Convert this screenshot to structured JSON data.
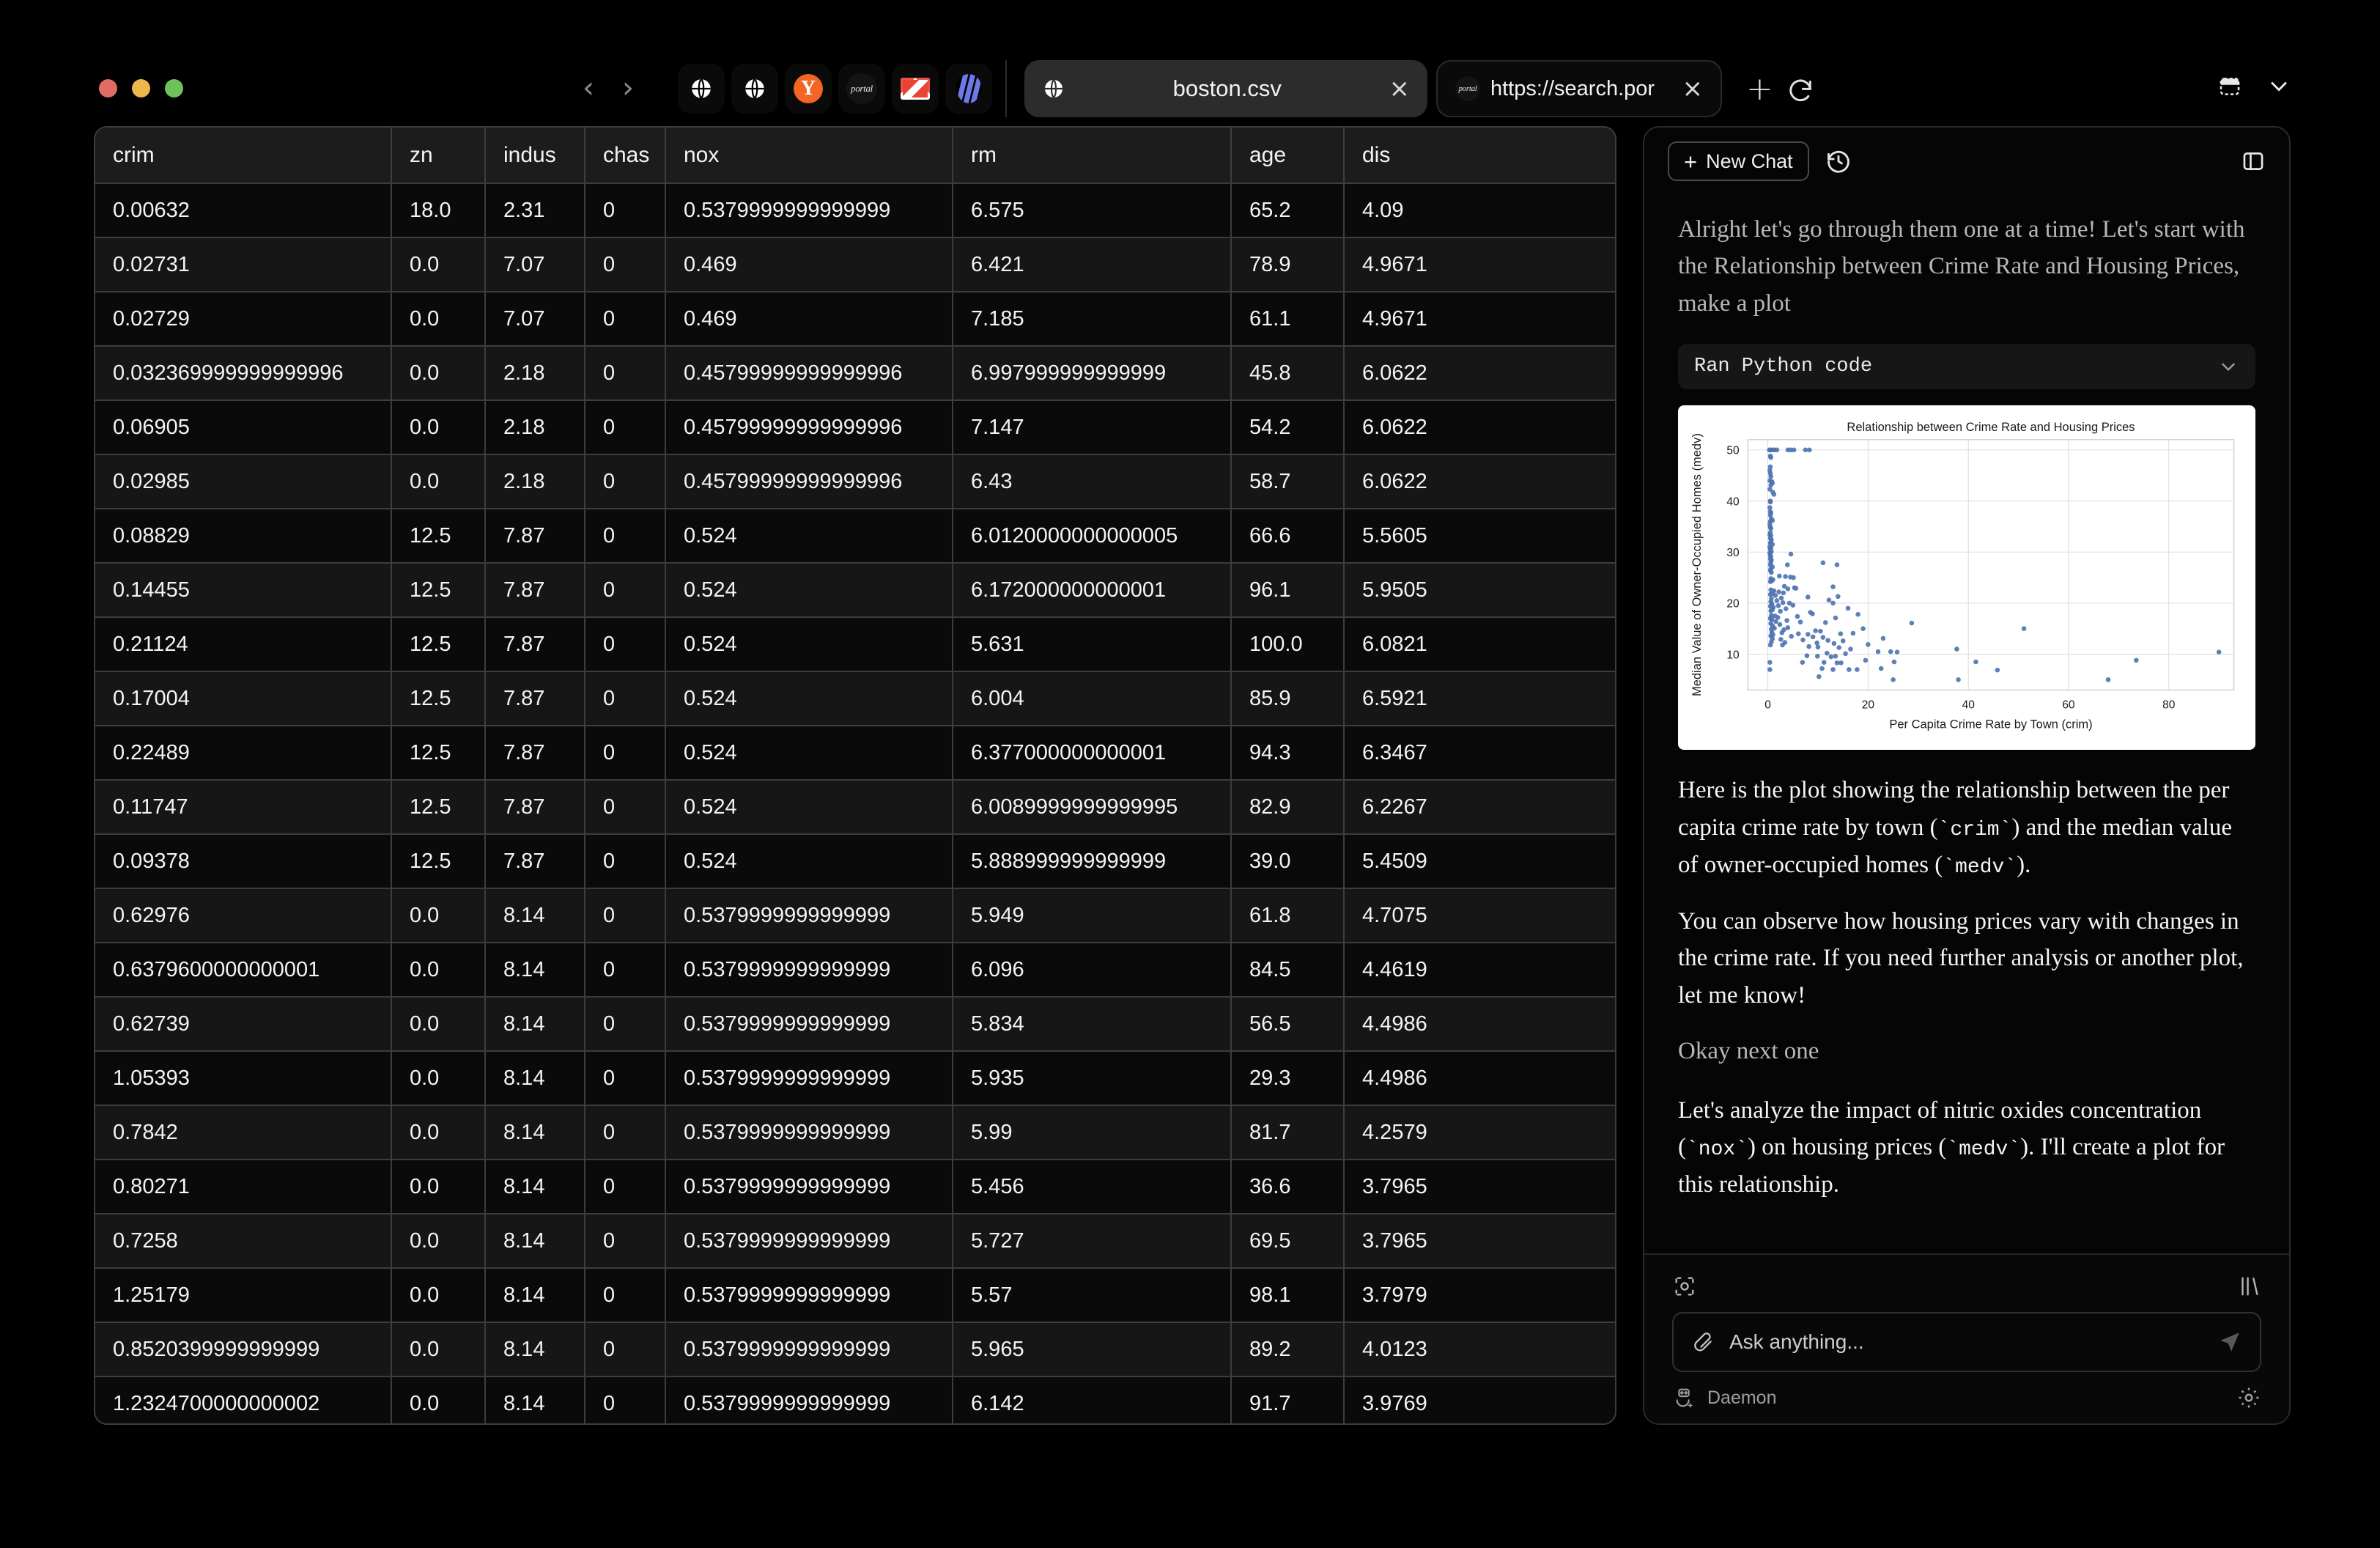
{
  "browser": {
    "window_controls": [
      "close",
      "minimize",
      "maximize"
    ],
    "back_label": "‹",
    "forward_label": "›",
    "pinned_tabs": [
      {
        "icon": "globe-icon",
        "label": ""
      },
      {
        "icon": "globe-icon",
        "label": ""
      },
      {
        "icon": "ycombinator-icon",
        "label": "Y"
      },
      {
        "icon": "portal-icon",
        "label": "portal"
      },
      {
        "icon": "gmail-icon",
        "label": ""
      },
      {
        "icon": "stripes-icon",
        "label": ""
      }
    ],
    "tabs": [
      {
        "title": "boston.csv",
        "icon": "globe-icon",
        "close": "×",
        "active": true
      },
      {
        "title": "https://search.por",
        "icon": "portal-icon",
        "close": "×",
        "active": false
      }
    ],
    "new_tab_label": "+",
    "reload_label": "reload-icon",
    "window_layout_icon": "window-layout-icon",
    "window_chevron_icon": "chevron-down-icon"
  },
  "table": {
    "columns": [
      "crim",
      "zn",
      "indus",
      "chas",
      "nox",
      "rm",
      "age",
      "dis"
    ],
    "rows": [
      [
        "0.00632",
        "18.0",
        "2.31",
        "0",
        "0.5379999999999999",
        "6.575",
        "65.2",
        "4.09"
      ],
      [
        "0.02731",
        "0.0",
        "7.07",
        "0",
        "0.469",
        "6.421",
        "78.9",
        "4.9671"
      ],
      [
        "0.02729",
        "0.0",
        "7.07",
        "0",
        "0.469",
        "7.185",
        "61.1",
        "4.9671"
      ],
      [
        "0.032369999999999996",
        "0.0",
        "2.18",
        "0",
        "0.45799999999999996",
        "6.997999999999999",
        "45.8",
        "6.0622"
      ],
      [
        "0.06905",
        "0.0",
        "2.18",
        "0",
        "0.45799999999999996",
        "7.147",
        "54.2",
        "6.0622"
      ],
      [
        "0.02985",
        "0.0",
        "2.18",
        "0",
        "0.45799999999999996",
        "6.43",
        "58.7",
        "6.0622"
      ],
      [
        "0.08829",
        "12.5",
        "7.87",
        "0",
        "0.524",
        "6.0120000000000005",
        "66.6",
        "5.5605"
      ],
      [
        "0.14455",
        "12.5",
        "7.87",
        "0",
        "0.524",
        "6.172000000000001",
        "96.1",
        "5.9505"
      ],
      [
        "0.21124",
        "12.5",
        "7.87",
        "0",
        "0.524",
        "5.631",
        "100.0",
        "6.0821"
      ],
      [
        "0.17004",
        "12.5",
        "7.87",
        "0",
        "0.524",
        "6.004",
        "85.9",
        "6.5921"
      ],
      [
        "0.22489",
        "12.5",
        "7.87",
        "0",
        "0.524",
        "6.377000000000001",
        "94.3",
        "6.3467"
      ],
      [
        "0.11747",
        "12.5",
        "7.87",
        "0",
        "0.524",
        "6.0089999999999995",
        "82.9",
        "6.2267"
      ],
      [
        "0.09378",
        "12.5",
        "7.87",
        "0",
        "0.524",
        "5.888999999999999",
        "39.0",
        "5.4509"
      ],
      [
        "0.62976",
        "0.0",
        "8.14",
        "0",
        "0.5379999999999999",
        "5.949",
        "61.8",
        "4.7075"
      ],
      [
        "0.6379600000000001",
        "0.0",
        "8.14",
        "0",
        "0.5379999999999999",
        "6.096",
        "84.5",
        "4.4619"
      ],
      [
        "0.62739",
        "0.0",
        "8.14",
        "0",
        "0.5379999999999999",
        "5.834",
        "56.5",
        "4.4986"
      ],
      [
        "1.05393",
        "0.0",
        "8.14",
        "0",
        "0.5379999999999999",
        "5.935",
        "29.3",
        "4.4986"
      ],
      [
        "0.7842",
        "0.0",
        "8.14",
        "0",
        "0.5379999999999999",
        "5.99",
        "81.7",
        "4.2579"
      ],
      [
        "0.80271",
        "0.0",
        "8.14",
        "0",
        "0.5379999999999999",
        "5.456",
        "36.6",
        "3.7965"
      ],
      [
        "0.7258",
        "0.0",
        "8.14",
        "0",
        "0.5379999999999999",
        "5.727",
        "69.5",
        "3.7965"
      ],
      [
        "1.25179",
        "0.0",
        "8.14",
        "0",
        "0.5379999999999999",
        "5.57",
        "98.1",
        "3.7979"
      ],
      [
        "0.8520399999999999",
        "0.0",
        "8.14",
        "0",
        "0.5379999999999999",
        "5.965",
        "89.2",
        "4.0123"
      ],
      [
        "1.2324700000000002",
        "0.0",
        "8.14",
        "0",
        "0.5379999999999999",
        "6.142",
        "91.7",
        "3.9769"
      ]
    ]
  },
  "chat": {
    "new_chat_label": "New Chat",
    "new_chat_plus": "+",
    "history_icon": "history-icon",
    "panel_toggle_icon": "panel-toggle-icon",
    "messages": [
      {
        "role": "user",
        "text": "Alright let's go through them one at a time! Let's start with the Relationship between Crime Rate and Housing Prices, make a plot"
      },
      {
        "role": "tool",
        "label": "Ran Python code",
        "chevron": "⌄"
      },
      {
        "role": "assistant",
        "text_parts": [
          {
            "type": "text",
            "value": "Here is the plot showing the relationship between the per capita crime rate by town ("
          },
          {
            "type": "code",
            "value": "`crim`"
          },
          {
            "type": "text",
            "value": ") and the median value of owner-occupied homes ("
          },
          {
            "type": "code",
            "value": "`medv`"
          },
          {
            "type": "text",
            "value": ")."
          }
        ],
        "text": "Here is the plot showing the relationship between the per capita crime rate by town (`crim`) and the median value of owner-occupied homes (`medv`)."
      },
      {
        "role": "assistant",
        "text": "You can observe how housing prices vary with changes in the crime rate. If you need further analysis or another plot, let me know!"
      },
      {
        "role": "user",
        "text": "Okay next one"
      },
      {
        "role": "assistant",
        "text": "Let's analyze the impact of nitric oxides concentration (`nox`) on housing prices (`medv`). I'll create a plot for this relationship."
      }
    ],
    "scroll_actions": [
      {
        "icon": "scroll-down-icon",
        "label": "↓"
      },
      {
        "icon": "regenerate-icon",
        "label": "↻"
      }
    ],
    "composer": {
      "scan_icon": "scan-icon",
      "library_icon": "library-icon",
      "attach_icon": "paperclip-icon",
      "placeholder": "Ask anything...",
      "send_icon": "send-icon",
      "agent_icon": "robot-icon",
      "agent_name": "Daemon",
      "settings_icon": "gear-icon"
    }
  },
  "chart_data": {
    "type": "scatter",
    "title": "Relationship between Crime Rate and Housing Prices",
    "xlabel": "Per Capita Crime Rate by Town (crim)",
    "ylabel": "Median Value of Owner-Occupied Homes (medv)",
    "xlim": [
      -4,
      93
    ],
    "ylim": [
      3,
      52
    ],
    "xticks": [
      0,
      20,
      40,
      60,
      80
    ],
    "yticks": [
      10,
      20,
      30,
      40,
      50
    ],
    "grid": true,
    "legend": "none",
    "marker_color": "#4c72b0",
    "plot_bg": "#ffffff",
    "points": [
      [
        0.3,
        50.0
      ],
      [
        0.5,
        50.0
      ],
      [
        0.9,
        50.0
      ],
      [
        1.3,
        50.0
      ],
      [
        1.8,
        50.0
      ],
      [
        4.0,
        50.0
      ],
      [
        4.6,
        50.0
      ],
      [
        5.2,
        50.0
      ],
      [
        7.5,
        50.0
      ],
      [
        8.3,
        50.0
      ],
      [
        0.5,
        48.8
      ],
      [
        0.6,
        48.5
      ],
      [
        0.5,
        46.7
      ],
      [
        0.4,
        46.0
      ],
      [
        0.5,
        45.4
      ],
      [
        0.6,
        44.8
      ],
      [
        0.4,
        44.0
      ],
      [
        0.8,
        43.8
      ],
      [
        0.9,
        43.5
      ],
      [
        0.6,
        43.1
      ],
      [
        0.4,
        42.3
      ],
      [
        1.0,
        41.7
      ],
      [
        1.2,
        41.3
      ],
      [
        0.5,
        40.0
      ],
      [
        0.5,
        39.8
      ],
      [
        0.4,
        38.7
      ],
      [
        0.5,
        37.9
      ],
      [
        0.6,
        37.6
      ],
      [
        0.5,
        37.2
      ],
      [
        0.7,
        36.5
      ],
      [
        0.9,
        36.2
      ],
      [
        0.5,
        36.0
      ],
      [
        0.4,
        35.4
      ],
      [
        0.5,
        34.9
      ],
      [
        0.6,
        34.6
      ],
      [
        0.5,
        33.8
      ],
      [
        0.4,
        33.4
      ],
      [
        0.6,
        33.2
      ],
      [
        0.5,
        32.7
      ],
      [
        0.7,
        32.4
      ],
      [
        0.6,
        32.0
      ],
      [
        0.5,
        31.7
      ],
      [
        0.9,
        31.5
      ],
      [
        0.4,
        31.0
      ],
      [
        0.6,
        30.8
      ],
      [
        0.5,
        30.5
      ],
      [
        0.7,
        30.1
      ],
      [
        0.4,
        29.8
      ],
      [
        4.6,
        29.6
      ],
      [
        0.5,
        29.4
      ],
      [
        0.6,
        29.1
      ],
      [
        0.5,
        28.7
      ],
      [
        0.7,
        28.4
      ],
      [
        0.6,
        28.0
      ],
      [
        0.5,
        27.5
      ],
      [
        3.9,
        27.5
      ],
      [
        11.0,
        27.9
      ],
      [
        13.8,
        27.5
      ],
      [
        0.9,
        27.1
      ],
      [
        0.6,
        26.7
      ],
      [
        0.5,
        26.4
      ],
      [
        0.7,
        26.0
      ],
      [
        2.3,
        25.3
      ],
      [
        3.5,
        25.2
      ],
      [
        4.5,
        25.1
      ],
      [
        5.1,
        25.0
      ],
      [
        0.6,
        24.8
      ],
      [
        1.0,
        24.6
      ],
      [
        0.8,
        24.4
      ],
      [
        0.5,
        24.2
      ],
      [
        13.0,
        23.2
      ],
      [
        5.3,
        23.0
      ],
      [
        5.6,
        22.9
      ],
      [
        3.3,
        23.3
      ],
      [
        4.0,
        22.8
      ],
      [
        0.6,
        22.6
      ],
      [
        1.2,
        22.4
      ],
      [
        2.2,
        22.2
      ],
      [
        3.1,
        22.0
      ],
      [
        0.9,
        21.9
      ],
      [
        0.5,
        21.7
      ],
      [
        1.5,
        21.5
      ],
      [
        8.0,
        21.2
      ],
      [
        14.0,
        21.3
      ],
      [
        2.7,
        21.0
      ],
      [
        0.7,
        20.9
      ],
      [
        12.2,
        20.6
      ],
      [
        1.8,
        20.5
      ],
      [
        0.6,
        20.3
      ],
      [
        3.0,
        20.1
      ],
      [
        4.3,
        20.0
      ],
      [
        13.0,
        20.0
      ],
      [
        0.8,
        19.9
      ],
      [
        5.0,
        19.6
      ],
      [
        2.1,
        19.5
      ],
      [
        0.5,
        19.4
      ],
      [
        1.1,
        19.2
      ],
      [
        16.0,
        19.0
      ],
      [
        3.6,
        18.9
      ],
      [
        0.9,
        18.7
      ],
      [
        0.6,
        18.5
      ],
      [
        2.5,
        18.4
      ],
      [
        8.5,
        18.2
      ],
      [
        8.9,
        17.9
      ],
      [
        18.0,
        17.8
      ],
      [
        0.7,
        17.6
      ],
      [
        1.4,
        17.5
      ],
      [
        5.9,
        17.4
      ],
      [
        2.0,
        17.2
      ],
      [
        13.5,
        17.1
      ],
      [
        0.5,
        17.0
      ],
      [
        0.8,
        16.8
      ],
      [
        3.8,
        16.6
      ],
      [
        1.6,
        16.4
      ],
      [
        6.5,
        16.3
      ],
      [
        11.5,
        16.2
      ],
      [
        28.7,
        16.1
      ],
      [
        0.6,
        16.0
      ],
      [
        2.4,
        15.8
      ],
      [
        0.9,
        15.6
      ],
      [
        51.1,
        15.0
      ],
      [
        19.0,
        15.0
      ],
      [
        4.0,
        15.2
      ],
      [
        1.3,
        15.1
      ],
      [
        0.7,
        14.9
      ],
      [
        3.2,
        14.8
      ],
      [
        9.5,
        14.6
      ],
      [
        10.5,
        14.5
      ],
      [
        14.5,
        14.0
      ],
      [
        17.0,
        14.1
      ],
      [
        0.8,
        14.3
      ],
      [
        2.8,
        14.2
      ],
      [
        6.1,
        14.0
      ],
      [
        8.0,
        13.9
      ],
      [
        1.0,
        13.8
      ],
      [
        0.6,
        13.6
      ],
      [
        4.7,
        13.5
      ],
      [
        9.0,
        13.4
      ],
      [
        11.0,
        13.3
      ],
      [
        23.0,
        13.1
      ],
      [
        0.9,
        13.0
      ],
      [
        2.6,
        12.9
      ],
      [
        7.0,
        12.8
      ],
      [
        12.0,
        12.7
      ],
      [
        15.0,
        12.6
      ],
      [
        0.7,
        12.4
      ],
      [
        3.4,
        12.3
      ],
      [
        9.8,
        12.2
      ],
      [
        13.2,
        12.1
      ],
      [
        20.0,
        11.9
      ],
      [
        0.5,
        11.8
      ],
      [
        2.9,
        11.8
      ],
      [
        8.2,
        11.5
      ],
      [
        10.0,
        11.4
      ],
      [
        14.2,
        11.3
      ],
      [
        16.5,
        11.0
      ],
      [
        37.7,
        11.0
      ],
      [
        22.0,
        10.5
      ],
      [
        24.5,
        10.5
      ],
      [
        25.8,
        10.4
      ],
      [
        90.0,
        10.4
      ],
      [
        11.8,
        10.2
      ],
      [
        15.5,
        10.1
      ],
      [
        7.8,
        9.7
      ],
      [
        9.9,
        9.6
      ],
      [
        13.5,
        9.6
      ],
      [
        12.6,
        9.5
      ],
      [
        0.4,
        8.4
      ],
      [
        6.9,
        8.4
      ],
      [
        11.2,
        8.4
      ],
      [
        13.8,
        8.3
      ],
      [
        14.6,
        8.3
      ],
      [
        19.5,
        8.8
      ],
      [
        25.2,
        8.5
      ],
      [
        41.5,
        8.5
      ],
      [
        73.5,
        8.8
      ],
      [
        0.4,
        7.0
      ],
      [
        10.8,
        7.2
      ],
      [
        13.0,
        7.0
      ],
      [
        16.2,
        7.0
      ],
      [
        17.8,
        7.0
      ],
      [
        22.6,
        7.2
      ],
      [
        45.8,
        6.9
      ],
      [
        10.2,
        5.6
      ],
      [
        25.0,
        5.0
      ],
      [
        38.0,
        5.0
      ],
      [
        67.9,
        5.0
      ]
    ]
  }
}
